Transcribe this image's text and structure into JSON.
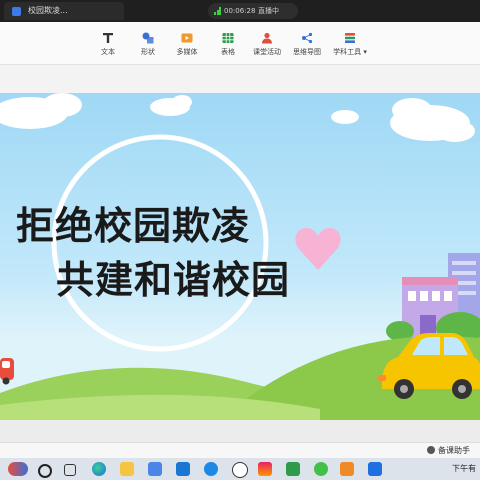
{
  "window": {
    "tab_title": "校园欺凌...",
    "timer": "00:06:28",
    "live_status": "直播中"
  },
  "toolbar": {
    "items": [
      {
        "label": "文本",
        "icon": "text-icon"
      },
      {
        "label": "形状",
        "icon": "shape-icon"
      },
      {
        "label": "多媒体",
        "icon": "media-icon"
      },
      {
        "label": "表格",
        "icon": "table-icon"
      },
      {
        "label": "课堂活动",
        "icon": "classroom-activity-icon"
      },
      {
        "label": "思维导图",
        "icon": "mindmap-icon"
      },
      {
        "label": "学科工具 ▾",
        "icon": "subject-tools-icon"
      }
    ]
  },
  "slide": {
    "title_line1": "拒绝校园欺凌",
    "title_line2": "共建和谐校园",
    "colors": {
      "sky": "#a6dbf6",
      "grass": "#8fcb52",
      "car": "#f7c400",
      "building": "#b7a5e6"
    }
  },
  "status_bar": {
    "assistant_label": "备课助手"
  },
  "taskbar": {
    "clock_text": "下午有",
    "icons": [
      "search-icon",
      "task-view-icon",
      "edge-icon",
      "file-explorer-icon",
      "store-icon",
      "mail-icon",
      "browser-icon",
      "w-app-icon",
      "paint-icon",
      "green-app-icon",
      "wechat-icon",
      "orange-app-icon",
      "blue-app-icon"
    ]
  }
}
